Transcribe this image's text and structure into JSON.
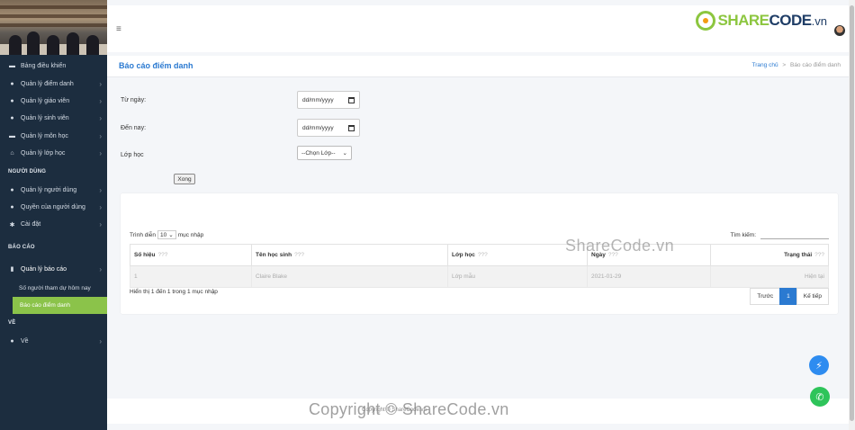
{
  "sidebar": {
    "items": [
      {
        "label": "Bảng điều khiển",
        "icon": "dashboard-icon",
        "glyph": "▬"
      },
      {
        "label": "Quản lý điểm danh",
        "icon": "clock-icon",
        "glyph": "●"
      },
      {
        "label": "Quản lý giáo viên",
        "icon": "user-icon",
        "glyph": "●"
      },
      {
        "label": "Quản lý sinh viên",
        "icon": "users-icon",
        "glyph": "●"
      },
      {
        "label": "Quản lý môn học",
        "icon": "book-icon",
        "glyph": "▬"
      },
      {
        "label": "Quản lý lớp học",
        "icon": "home-icon",
        "glyph": "⌂"
      }
    ],
    "section_users": "NGƯỜI DÙNG",
    "user_items": [
      {
        "label": "Quản lý người dùng",
        "icon": "user-plus-icon",
        "glyph": "●"
      },
      {
        "label": "Quyền của người dùng",
        "icon": "key-icon",
        "glyph": "●"
      },
      {
        "label": "Cài đặt",
        "icon": "gear-icon",
        "glyph": "✱"
      }
    ],
    "section_reports": "BÁO CÁO",
    "report_item": "Quản lý báo cáo",
    "report_subs": [
      "Số người tham dự hôm nay",
      "Báo cáo điểm danh"
    ],
    "section_about": "VỀ",
    "about_item": "Về"
  },
  "header": {
    "logo_part1": "SHARE",
    "logo_part2": "CODE",
    "logo_part3": ".vn"
  },
  "page": {
    "title": "Báo cáo điểm danh",
    "breadcrumb_home": "Trang chủ",
    "breadcrumb_sep": ">",
    "breadcrumb_current": "Báo cáo điểm danh"
  },
  "filter": {
    "from_label": "Từ ngày:",
    "to_label": "Đến nay:",
    "class_label": "Lớp học",
    "date_placeholder": "dd/mm/yyyy",
    "class_select": "--Chọn Lớp--",
    "submit": "Xong"
  },
  "table": {
    "show_prefix": "Trình diễn",
    "page_length": "10",
    "show_suffix": "mục nhập",
    "search_label": "Tìm kiếm:",
    "sort_hint": "???",
    "columns": [
      "Số hiệu",
      "Tên học sinh",
      "Lớp học",
      "Ngày",
      "Trạng thái"
    ],
    "rows": [
      [
        "1",
        "Claire Blake",
        "Lớp mẫu",
        "2021-01-29",
        "Hiện tại"
      ]
    ],
    "info": "Hiển thị 1 đến 1 trong 1 mục nhập",
    "prev": "Trước",
    "page": "1",
    "next": "Kế tiếp"
  },
  "footer": {
    "text": "Copyright © ShareCode.vn"
  },
  "watermark": {
    "top": "ShareCode.vn",
    "bottom": "Copyright © ShareCode.vn"
  }
}
